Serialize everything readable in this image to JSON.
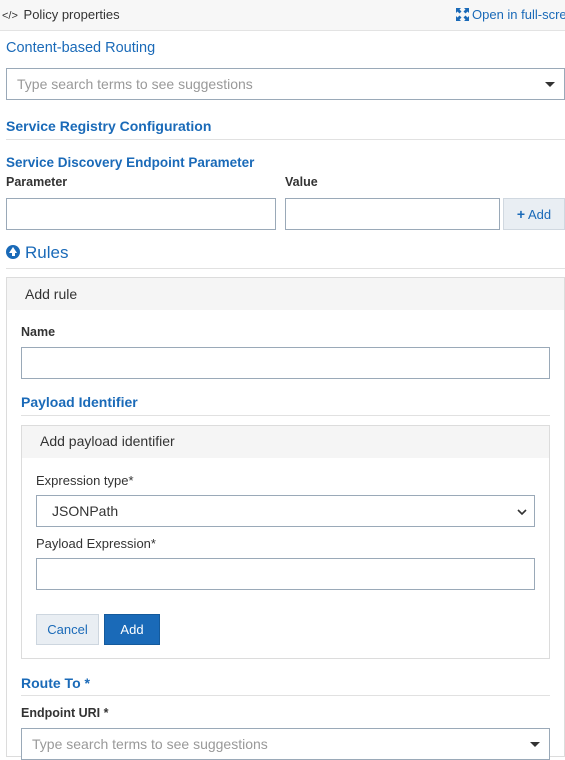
{
  "header": {
    "title": "Policy properties",
    "title_icon": "code-icon",
    "fullscreen_label": "Open in full-scre"
  },
  "content_routing": {
    "heading": "Content-based Routing",
    "search_placeholder": "Type search terms to see suggestions"
  },
  "service_registry": {
    "heading": "Service Registry Configuration",
    "sub_heading": "Service Discovery Endpoint Parameter",
    "parameter_label": "Parameter",
    "value_label": "Value",
    "parameter_value": "",
    "value_value": "",
    "add_label": "Add",
    "add_icon": "+"
  },
  "rules": {
    "heading": "Rules",
    "add_rule": {
      "title": "Add rule",
      "name_label": "Name",
      "name_value": "",
      "payload_identifier_heading": "Payload Identifier",
      "payload": {
        "title": "Add payload identifier",
        "expression_type_label": "Expression type*",
        "expression_type_value": "JSONPath",
        "payload_expression_label": "Payload Expression*",
        "payload_expression_value": "",
        "cancel_label": "Cancel",
        "add_label": "Add"
      },
      "route_to_heading": "Route To *",
      "endpoint_uri_label": "Endpoint URI *",
      "endpoint_uri_placeholder": "Type search terms to see suggestions"
    }
  },
  "colors": {
    "accent": "#1a6ab8",
    "panel_header": "#f5f5f5"
  }
}
